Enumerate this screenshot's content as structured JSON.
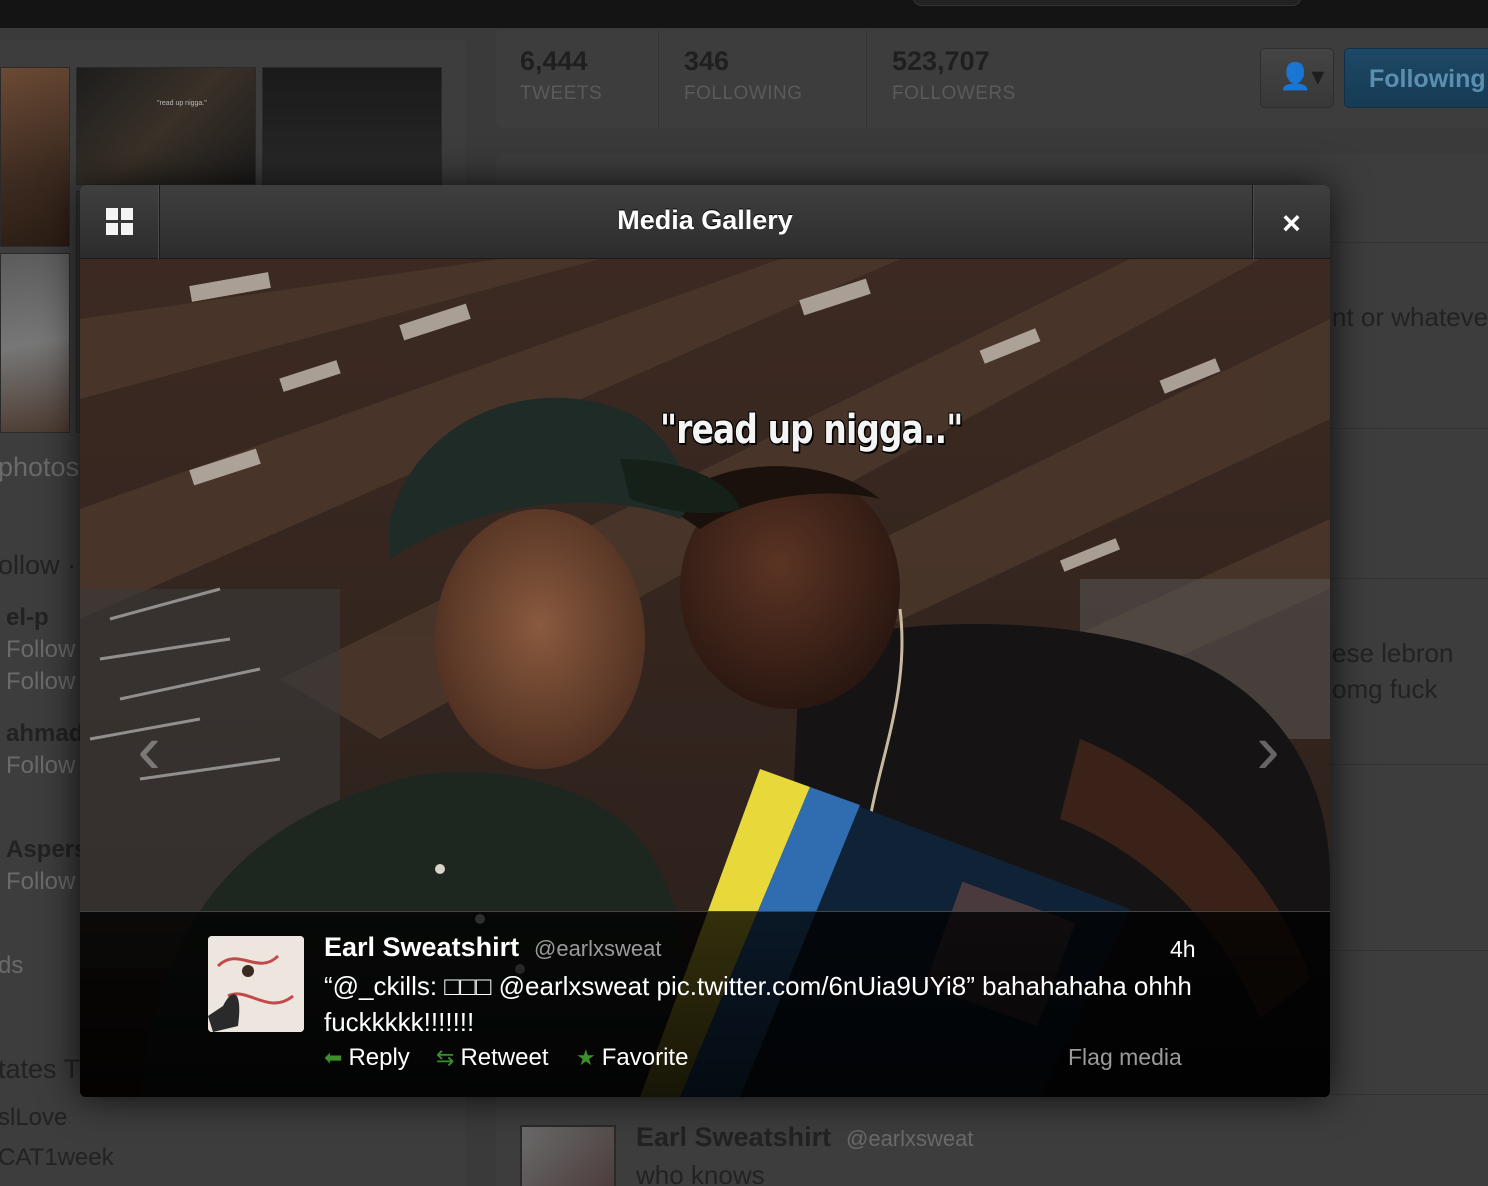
{
  "background": {
    "left_photos_label": "photos",
    "photo_tiny_caption": "\"read up nigga.\"",
    "who_to_follow_label": "ollow ·",
    "suggestions": [
      {
        "name": "el-p",
        "action": "Follow"
      },
      {
        "name": "",
        "action": "Follow"
      },
      {
        "name": "ahmad",
        "action": "Follow"
      },
      {
        "name": "Aspers",
        "action": "Follow"
      }
    ],
    "trends_label": "ds",
    "trends_title": "tates T",
    "trend_items": [
      "slLove",
      "CAT1week"
    ],
    "stats": [
      {
        "value": "6,444",
        "label": "TWEETS"
      },
      {
        "value": "346",
        "label": "FOLLOWING"
      },
      {
        "value": "523,707",
        "label": "FOLLOWERS"
      }
    ],
    "following_button": "Following",
    "feed_snippets": [
      "nt or whateve",
      "ese lebron",
      "omg fuck"
    ],
    "bottom_tweet_name": "Earl Sweatshirt",
    "bottom_tweet_handle": "@earlxsweat",
    "bottom_tweet_text": "who knows"
  },
  "modal": {
    "title": "Media Gallery",
    "close_label": "×",
    "image_caption": "\"read up nigga..\"",
    "prev_label": "‹",
    "next_label": "›",
    "tweet": {
      "name": "Earl Sweatshirt",
      "handle": "@earlxsweat",
      "time": "4h",
      "text": "“@_ckills: □□□ @earlxsweat pic.twitter.com/6nUia9UYi8” bahahahaha ohhh fuckkkkk!!!!!!!",
      "actions": {
        "reply": "Reply",
        "retweet": "Retweet",
        "favorite": "Favorite"
      },
      "flag": "Flag media"
    }
  }
}
